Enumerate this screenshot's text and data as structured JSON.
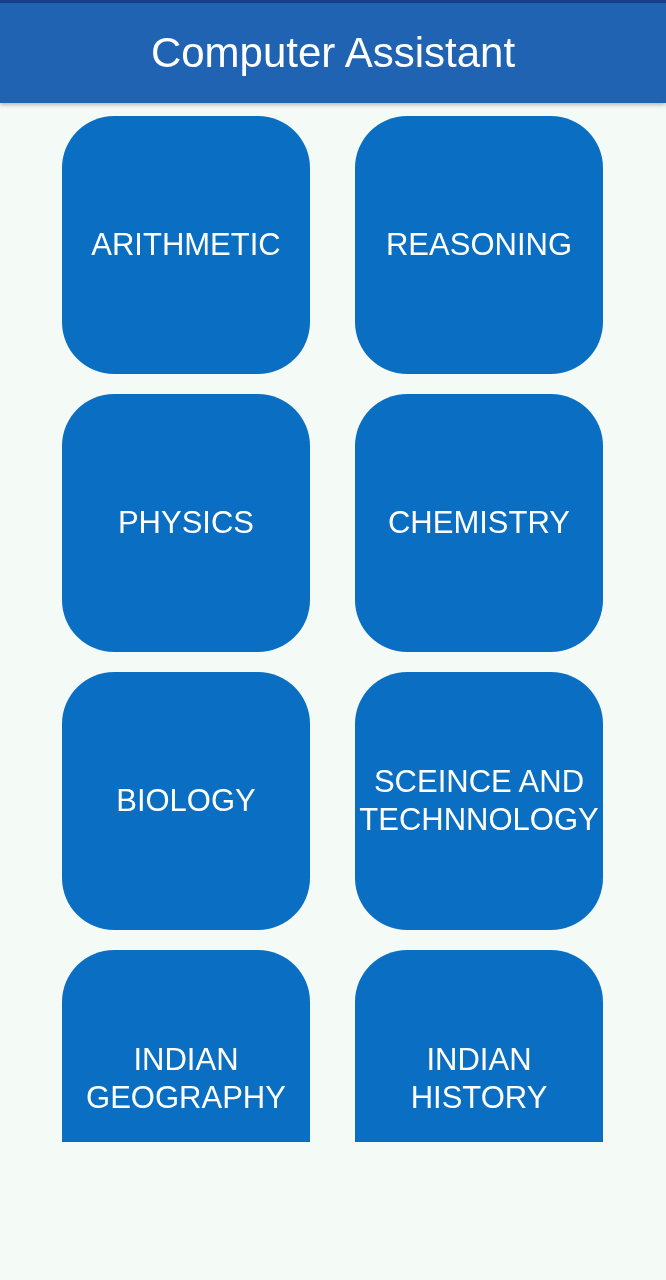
{
  "app_bar": {
    "title": "Computer Assistant"
  },
  "rows": [
    {
      "subjects": [
        {
          "label": "ARITHMETIC"
        },
        {
          "label": "REASONING"
        }
      ]
    },
    {
      "subjects": [
        {
          "label": "PHYSICS"
        },
        {
          "label": "CHEMISTRY"
        }
      ]
    },
    {
      "subjects": [
        {
          "label": "BIOLOGY"
        },
        {
          "label": "SCEINCE AND TECHNNOLOGY"
        }
      ]
    },
    {
      "subjects": [
        {
          "label": "INDIAN GEOGRAPHY"
        },
        {
          "label": "INDIAN HISTORY"
        }
      ]
    }
  ]
}
